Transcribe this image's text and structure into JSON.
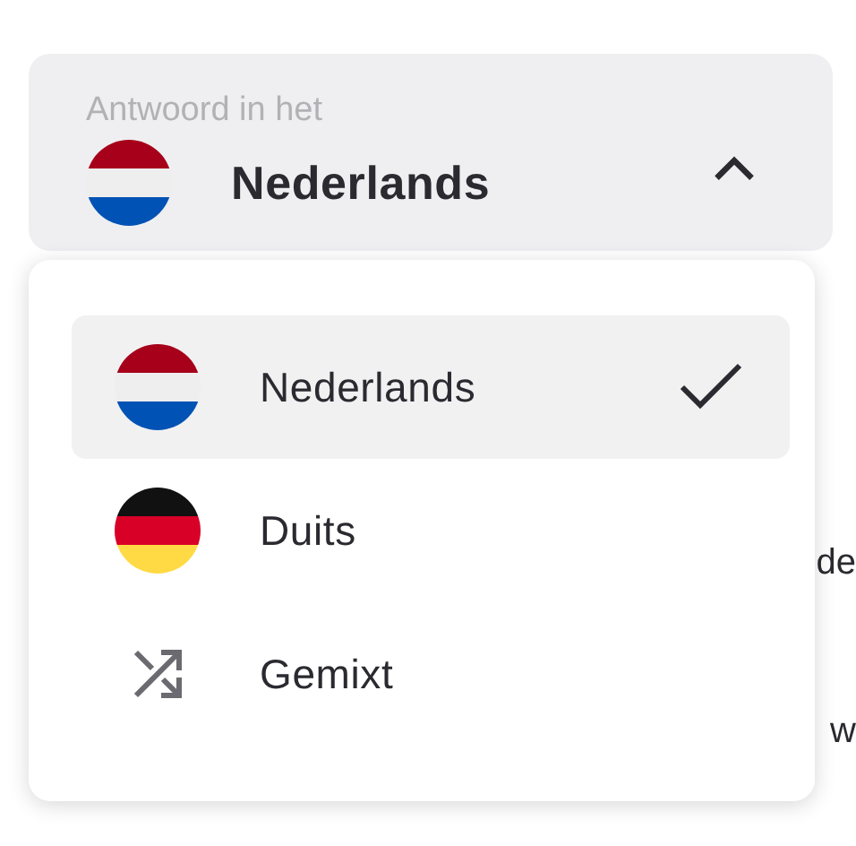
{
  "select": {
    "label": "Antwoord in het",
    "value": "Nederlands",
    "kind": "flag-nl",
    "expanded": true
  },
  "menu": {
    "items": [
      {
        "label": "Nederlands",
        "kind": "flag-nl",
        "selected": true
      },
      {
        "label": "Duits",
        "kind": "flag-de",
        "selected": false
      },
      {
        "label": "Gemixt",
        "kind": "shuffle",
        "selected": false
      }
    ]
  },
  "background_texts": [
    "de",
    "w"
  ]
}
